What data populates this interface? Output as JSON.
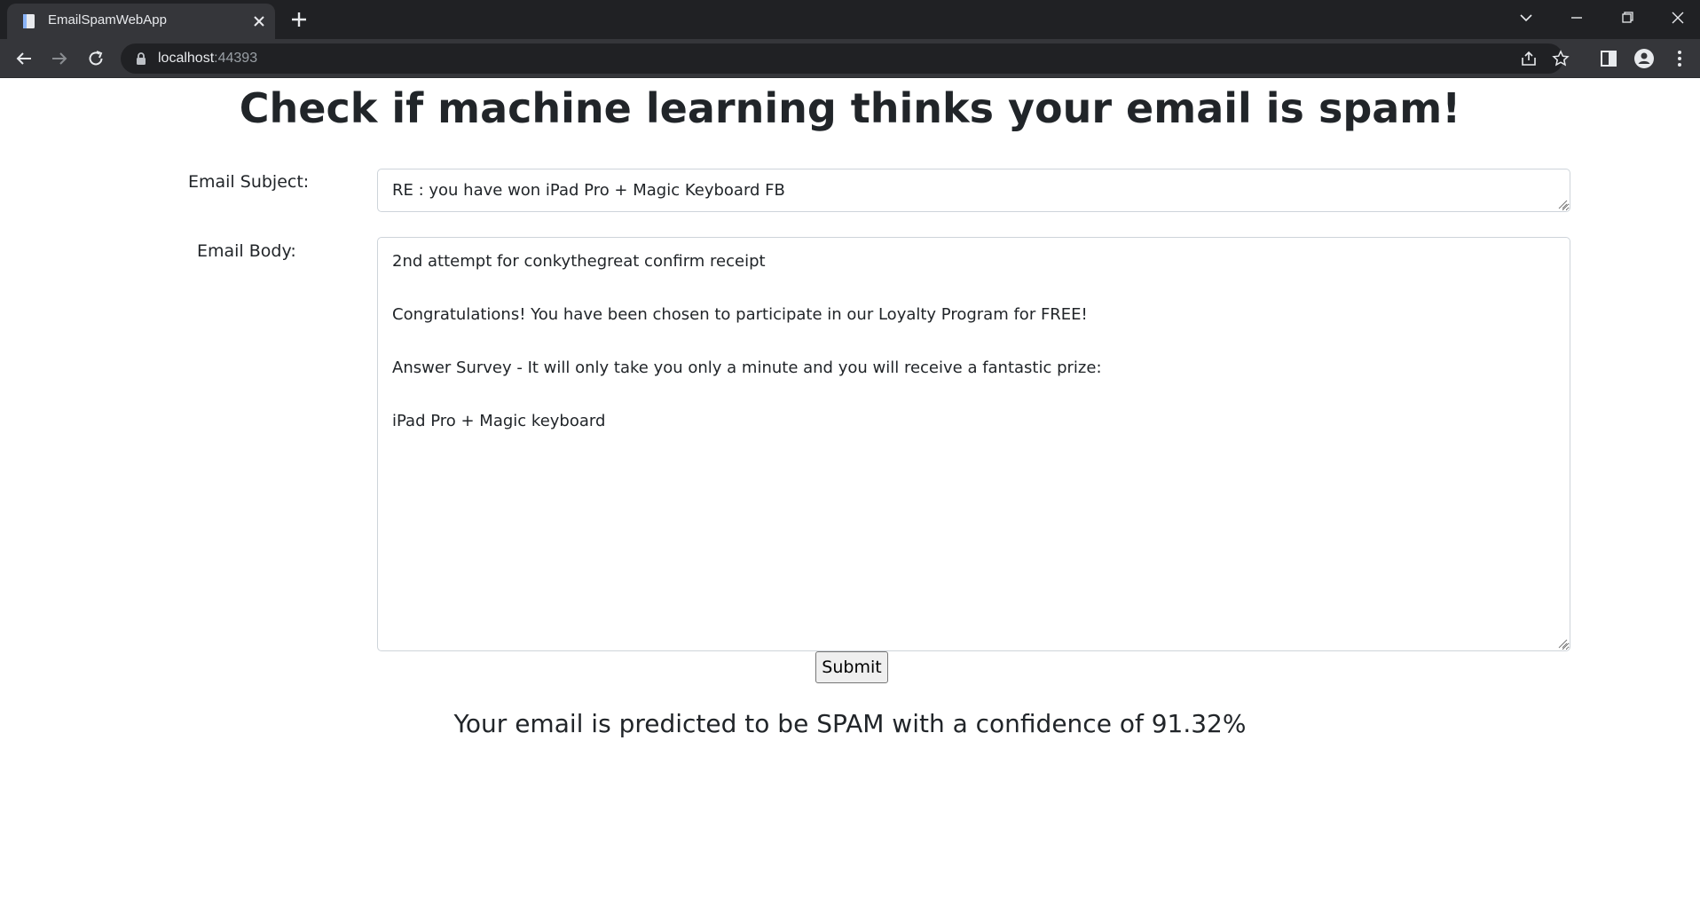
{
  "browser": {
    "tab_title": "EmailSpamWebApp",
    "url_host": "localhost",
    "url_port": ":44393"
  },
  "page": {
    "title": "Check if machine learning thinks your email is spam!",
    "subject_label": "Email Subject:",
    "subject_value": "RE : you have won iPad Pro + Magic Keyboard FB",
    "body_label": "Email Body:",
    "body_value": "2nd attempt for conkythegreat confirm receipt\n\nCongratulations! You have been chosen to participate in our Loyalty Program for FREE!\n\nAnswer Survey - It will only take you only a minute and you will receive a fantastic prize:\n\niPad Pro + Magic keyboard",
    "submit_label": "Submit",
    "result_text": "Your email is predicted to be SPAM with a confidence of 91.32%"
  }
}
